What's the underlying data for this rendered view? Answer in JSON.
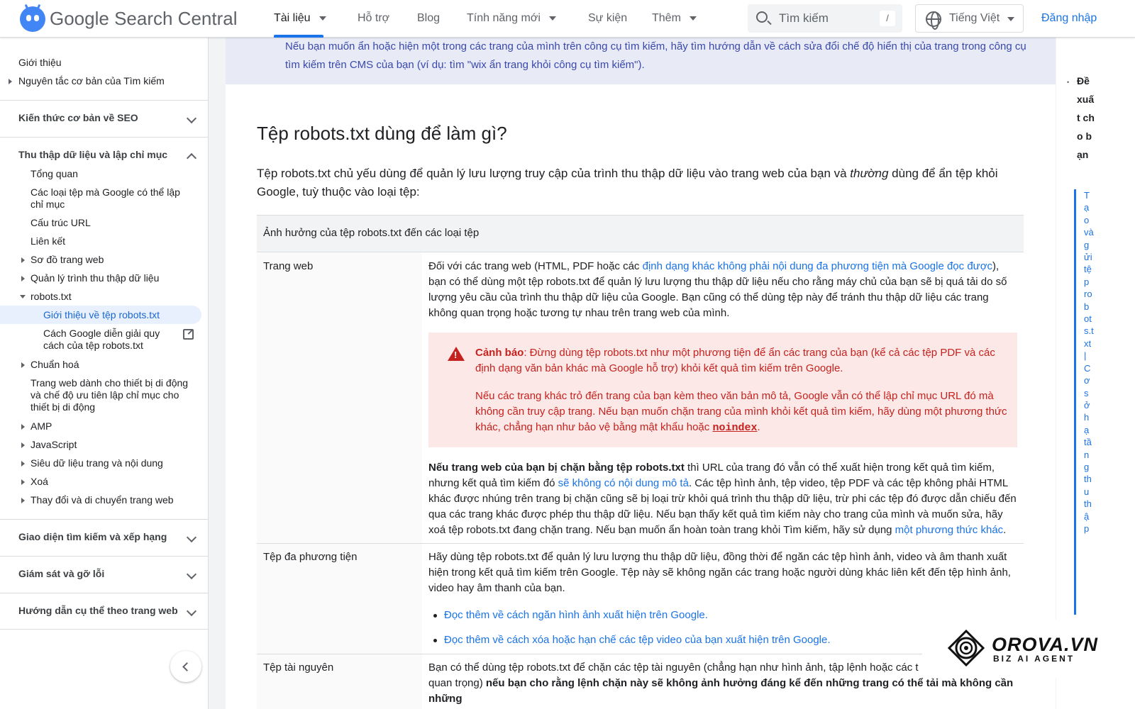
{
  "header": {
    "brand": "Google Search Central",
    "nav": [
      {
        "label": "Tài liệu"
      },
      {
        "label": "Hỗ trợ"
      },
      {
        "label": "Blog"
      },
      {
        "label": "Tính năng mới"
      },
      {
        "label": "Sự kiện"
      },
      {
        "label": "Thêm"
      }
    ],
    "search_placeholder": "Tìm kiếm",
    "search_shortcut": "/",
    "language": "Tiếng Việt",
    "signin": "Đăng nhập"
  },
  "sidebar": {
    "top_items": [
      "Giới thiệu",
      "Nguyên tắc cơ bản của Tìm kiếm"
    ],
    "sections": [
      "Kiến thức cơ bản về SEO",
      "Thu thập dữ liệu và lập chỉ mục",
      "Giao diện tìm kiếm và xếp hạng",
      "Giám sát và gỡ lỗi",
      "Hướng dẫn cụ thể theo trang web"
    ],
    "crawl_items": [
      "Tổng quan",
      "Các loại tệp mà Google có thể lập chỉ mục",
      "Cấu trúc URL",
      "Liên kết",
      "Sơ đồ trang web",
      "Quản lý trình thu thập dữ liệu",
      "robots.txt",
      "Giới thiệu về tệp robots.txt",
      "Cách Google diễn giải quy cách của tệp robots.txt",
      "Chuẩn hoá",
      "Trang web dành cho thiết bị di động và chế độ ưu tiên lập chỉ mục cho thiết bị di động",
      "AMP",
      "JavaScript",
      "Siêu dữ liệu trang và nội dung",
      "Xoá",
      "Thay đổi và di chuyển trang web"
    ]
  },
  "main": {
    "note": "Nếu bạn muốn ẩn hoặc hiện một trong các trang của mình trên công cụ tìm kiếm, hãy tìm hướng dẫn về cách sửa đổi chế độ hiển thị của trang trong công cụ tìm kiếm trên CMS của bạn (ví dụ: tìm \"wix ẩn trang khỏi công cụ tìm kiếm\").",
    "heading": "Tệp robots.txt dùng để làm gì?",
    "intro_a": "Tệp robots.txt chủ yếu dùng để quản lý lưu lượng truy cập của trình thu thập dữ liệu vào trang web của bạn và ",
    "intro_em": "thường",
    "intro_b": " dùng để ẩn tệp khỏi Google, tuỳ thuộc vào loại tệp:",
    "table_header": "Ảnh hưởng của tệp robots.txt đến các loại tệp",
    "row1_label": "Trang web",
    "row1_p1_a": "Đối với các trang web (HTML, PDF hoặc các ",
    "row1_p1_link": "định dạng khác không phải nội dung đa phương tiện mà Google đọc được",
    "row1_p1_b": "), bạn có thể dùng một tệp robots.txt để quản lý lưu lượng thu thập dữ liệu nếu cho rằng máy chủ của bạn sẽ bị quá tải do số lượng yêu cầu của trình thu thập dữ liệu của Google. Bạn cũng có thể dùng tệp này để tránh thu thập dữ liệu các trang không quan trọng hoặc tương tự nhau trên trang web của mình.",
    "warn_label": "Cảnh báo",
    "warn_p1": ": Đừng dùng tệp robots.txt như một phương tiện để ẩn các trang của bạn (kể cả các tệp PDF và các định dạng văn bản khác mà Google hỗ trợ) khỏi kết quả tìm kiếm trên Google.",
    "warn_p2": "Nếu các trang khác trỏ đến trang của bạn kèm theo văn bản mô tả, Google vẫn có thể lập chỉ mục URL đó mà không cần truy cập trang. Nếu bạn muốn chặn trang của mình khỏi kết quả tìm kiếm, hãy dùng một phương thức khác, chẳng hạn như bảo vệ bằng mật khẩu hoặc ",
    "warn_code": "noindex",
    "warn_end": ".",
    "row1_p2_bold": "Nếu trang web của bạn bị chặn bằng tệp robots.txt",
    "row1_p2_a": " thì URL của trang đó vẫn có thể xuất hiện trong kết quả tìm kiếm, nhưng kết quả tìm kiếm đó ",
    "row1_p2_link1": "sẽ không có nội dung mô tả",
    "row1_p2_b": ". Các tệp hình ảnh, tệp video, tệp PDF và các tệp không phải HTML khác được nhúng trên trang bị chặn cũng sẽ bị loại trừ khỏi quá trình thu thập dữ liệu, trừ phi các tệp đó được dẫn chiếu đến qua các trang khác được phép thu thập dữ liệu. Nếu bạn thấy kết quả tìm kiếm này cho trang của mình và muốn sửa, hãy xoá tệp robots.txt đang chặn trang. Nếu bạn muốn ẩn hoàn toàn trang khỏi Tìm kiếm, hãy sử dụng ",
    "row1_p2_link2": "một phương thức khác",
    "row1_p2_end": ".",
    "row2_label": "Tệp đa phương tiện",
    "row2_p": "Hãy dùng tệp robots.txt để quản lý lưu lượng thu thập dữ liệu, đồng thời để ngăn các tệp hình ảnh, video và âm thanh xuất hiện trong kết quả tìm kiếm trên Google. Tệp này sẽ không ngăn các trang hoặc người dùng khác liên kết đến tệp hình ảnh, video hay âm thanh của bạn.",
    "row2_links": [
      "Đọc thêm về cách ngăn hình ảnh xuất hiện trên Google.",
      "Đọc thêm về cách xóa hoặc hạn chế các tệp video của bạn xuất hiện trên Google."
    ],
    "row3_label": "Tệp tài nguyên",
    "row3_a": "Bạn có thể dùng tệp robots.txt để chặn các tệp tài nguyên (chẳng hạn như hình ảnh, tập lệnh hoặc các t",
    "row3_b": "quan trọng) ",
    "row3_bold": "nếu bạn cho rằng lệnh chặn này sẽ không ảnh hưởng đáng kể đến những trang có thể tải mà không cần những"
  },
  "toc": {
    "heading": "Đề xuất cho bạn",
    "link": "Tạo và gửi tệp robots.txt | Cơ sở hạ tầng thu thập"
  },
  "watermark": {
    "name": "OROVA.VN",
    "sub": "BIZ AI AGENT"
  },
  "colors": {
    "accent": "#1a73e8",
    "note_bg": "#e8eaf6",
    "warning_bg": "#fce8e6",
    "warning_text": "#c5221f"
  }
}
